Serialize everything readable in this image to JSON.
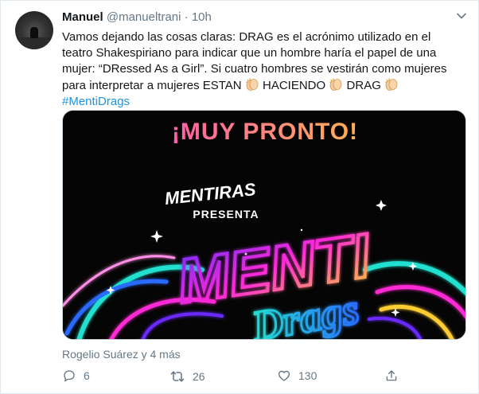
{
  "tweet": {
    "author_name": "Manuel",
    "author_handle": "@manueltrani",
    "separator": "·",
    "time": "10h",
    "text_line1": "Vamos dejando las cosas claras: DRAG es el acrónimo utilizado en el",
    "text_line2": "teatro Shakespiriano para indicar que un hombre haría el papel de una",
    "text_line3": "mujer: “DRessed As a Girl”. Si cuatro hombres se vestirán como mujeres",
    "text_line4_a": "para interpretar a mujeres ESTAN",
    "text_line4_b": "HACIENDO",
    "text_line4_c": "DRAG",
    "hashtag": "#MentiDrags"
  },
  "media": {
    "headline": "¡MUY PRONTO!",
    "brand": "MENTIRAS",
    "presenta": "PRESENTA",
    "logo_top": "MENTI",
    "logo_bottom": "Drags"
  },
  "social_context": "Rogelio Suárez y 4 más",
  "actions": {
    "reply_count": "6",
    "retweet_count": "26",
    "like_count": "130"
  },
  "colors": {
    "hashtag": "#1b95e0",
    "muted": "#657786",
    "headline_gradient": [
      "#ff5fa8",
      "#ffb050"
    ],
    "neon_pink": "#ff2bd6",
    "neon_teal": "#22e0d0"
  },
  "icons": [
    "chevron-down-icon",
    "clapping-hands-icon",
    "reply-icon",
    "retweet-icon",
    "like-icon",
    "share-icon"
  ]
}
